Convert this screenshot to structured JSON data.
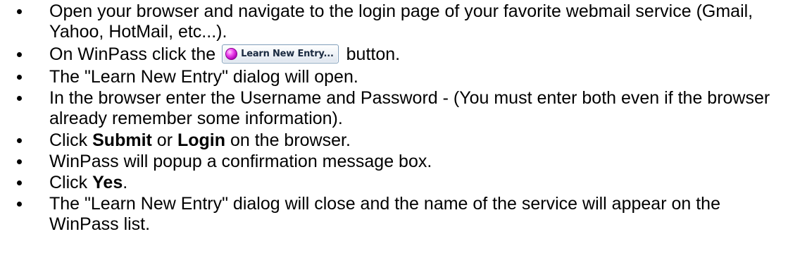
{
  "steps": [
    {
      "text": "Open your browser and navigate to the login page of your favorite webmail service (Gmail, Yahoo, HotMail, etc...)."
    },
    {
      "before": "On WinPass click the",
      "button_label": "Learn New Entry...",
      "button_icon": "magenta-orb-icon",
      "after": "button."
    },
    {
      "text": "The \"Learn New Entry\" dialog will open."
    },
    {
      "text": "In the browser enter the Username and Password - (You must enter both even if the browser already remember some information)."
    },
    {
      "before": "Click",
      "bold1": "Submit",
      "middle": "or",
      "bold2": "Login",
      "after": "on the browser."
    },
    {
      "text": "WinPass will popup a confirmation message box."
    },
    {
      "before": "Click",
      "bold1": "Yes",
      "after": "."
    },
    {
      "text": "The \"Learn New Entry\" dialog will close and the name of the service will appear on the WinPass list."
    }
  ]
}
